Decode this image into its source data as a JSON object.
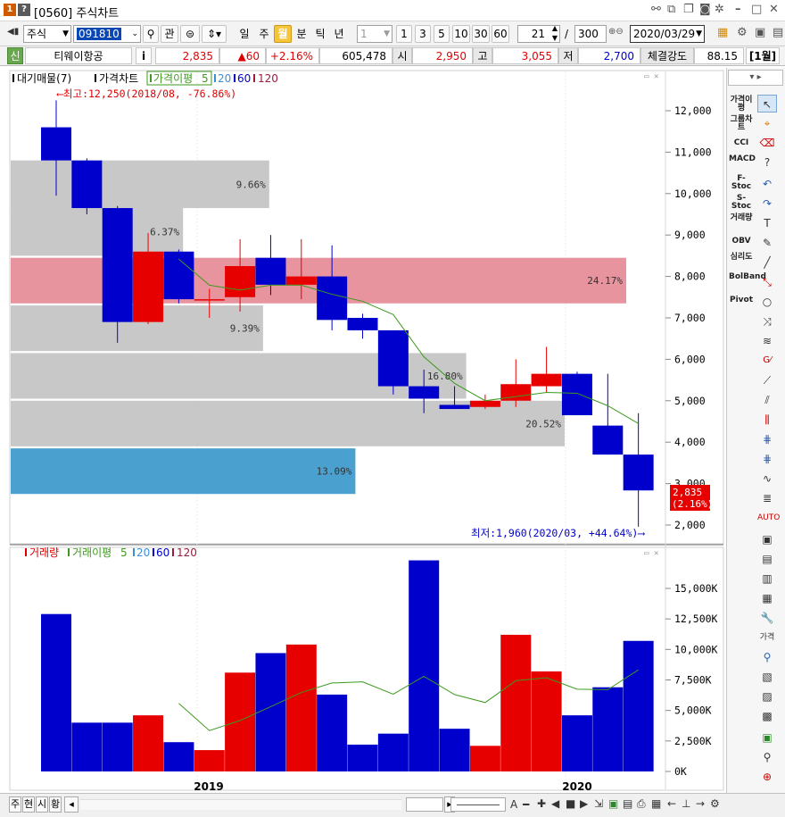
{
  "window": {
    "code_title": "[0560] 주식차트",
    "num": "1",
    "help": "?"
  },
  "toolbar": {
    "market": "주식",
    "code": "091810",
    "periods": [
      "일",
      "주",
      "월",
      "분",
      "틱",
      "년"
    ],
    "active_period": "월",
    "interval_select": "1",
    "intervals": [
      "1",
      "3",
      "5",
      "10",
      "30",
      "60"
    ],
    "count": "21",
    "count_cur": "300",
    "count_sep": "/",
    "date": "2020/03/29",
    "btn_gwan": "관"
  },
  "quote": {
    "shin": "신",
    "name": "티웨이항공",
    "info": "i",
    "price": "2,835",
    "change": "▲60",
    "change_pct": "+2.16%",
    "volume": "605,478",
    "open_label": "시",
    "open": "2,950",
    "high_label": "고",
    "high": "3,055",
    "low_label": "저",
    "low": "2,700",
    "strength_label": "체결강도",
    "strength": "88.15",
    "month": "[1월]"
  },
  "legend": {
    "vp": "대기매물(7)",
    "price": "가격차트",
    "ma_label": "가격이평",
    "ma": [
      "5",
      "20",
      "60",
      "120"
    ]
  },
  "vol_legend": {
    "vol": "거래량",
    "ma_label": "거래이평",
    "ma": [
      "5",
      "20",
      "60",
      "120"
    ]
  },
  "annotations": {
    "high": "⟵최고:12,250(2018/08, -76.86%)",
    "low": "최저:1,960(2020/03, +44.64%)⟶",
    "last_price": "2,835",
    "last_pct": "(2.16%)"
  },
  "x_labels": [
    "2019",
    "2020"
  ],
  "bottom": {
    "tabs": [
      "주",
      "현",
      "시",
      "황"
    ]
  },
  "indicators": [
    "가격이평",
    "그룹차트",
    "CCI",
    "MACD",
    "F-Stoc",
    "S-Stoc",
    "거래량",
    "OBV",
    "심리도",
    "BolBand",
    "Pivot"
  ],
  "colors": {
    "up": "#e60000",
    "down": "#0000cc",
    "ma5": "#3d9a1e",
    "vp": "#c8c8c8",
    "vp_max": "#e8949e",
    "vp_cur": "#4aa1cf"
  },
  "chart_data": {
    "type": "candlestick",
    "price_axis": {
      "min": 1500,
      "max": 12750,
      "ticks": [
        2000,
        3000,
        4000,
        5000,
        6000,
        7000,
        8000,
        9000,
        10000,
        11000,
        12000
      ]
    },
    "candles": [
      {
        "o": 11600,
        "h": 12250,
        "l": 9950,
        "c": 10800
      },
      {
        "o": 10800,
        "h": 10850,
        "l": 9500,
        "c": 9650
      },
      {
        "o": 9650,
        "h": 9700,
        "l": 6400,
        "c": 6900
      },
      {
        "o": 6900,
        "h": 9050,
        "l": 6850,
        "c": 8600
      },
      {
        "o": 8600,
        "h": 8650,
        "l": 7350,
        "c": 7450
      },
      {
        "o": 7450,
        "h": 7700,
        "l": 7000,
        "c": 7450
      },
      {
        "o": 7500,
        "h": 8900,
        "l": 7150,
        "c": 8250
      },
      {
        "o": 8450,
        "h": 9000,
        "l": 7550,
        "c": 7800
      },
      {
        "o": 7800,
        "h": 8900,
        "l": 7450,
        "c": 8000
      },
      {
        "o": 8000,
        "h": 8750,
        "l": 6700,
        "c": 6950
      },
      {
        "o": 7000,
        "h": 7100,
        "l": 6500,
        "c": 6700
      },
      {
        "o": 6700,
        "h": 6700,
        "l": 5150,
        "c": 5350
      },
      {
        "o": 5350,
        "h": 5750,
        "l": 4700,
        "c": 5050
      },
      {
        "o": 4900,
        "h": 5350,
        "l": 4800,
        "c": 4800
      },
      {
        "o": 4850,
        "h": 5150,
        "l": 4800,
        "c": 5000
      },
      {
        "o": 5000,
        "h": 6000,
        "l": 4850,
        "c": 5400
      },
      {
        "o": 5350,
        "h": 6300,
        "l": 5200,
        "c": 5650
      },
      {
        "o": 5650,
        "h": 5700,
        "l": 4650,
        "c": 4650
      },
      {
        "o": 4400,
        "h": 5650,
        "l": 3700,
        "c": 3700
      },
      {
        "o": 3700,
        "h": 4700,
        "l": 1960,
        "c": 2835
      }
    ],
    "ma5": [
      null,
      null,
      null,
      null,
      8420,
      7790,
      7670,
      7790,
      7790,
      7570,
      7400,
      7080,
      6060,
      5420,
      5000,
      5100,
      5200,
      5180,
      4880,
      4450
    ],
    "volume_axis": {
      "min": 0,
      "max": 18000,
      "ticks": [
        0,
        2500,
        5000,
        7500,
        10000,
        12500,
        15000
      ],
      "tick_labels": [
        "0K",
        "2,500K",
        "5,000K",
        "7,500K",
        "10,000K",
        "12,500K",
        "15,000K"
      ]
    },
    "volumes": [
      12900,
      4000,
      4000,
      4600,
      2400,
      1750,
      8100,
      9700,
      10400,
      6300,
      2200,
      3100,
      17300,
      3500,
      2100,
      11200,
      8200,
      4600,
      6900,
      10700
    ],
    "vol_ma5": [
      null,
      null,
      null,
      null,
      5580,
      3350,
      4170,
      5310,
      6470,
      7250,
      7340,
      6330,
      7800,
      6300,
      5650,
      7440,
      7680,
      6740,
      6700,
      8330
    ],
    "volume_profile": [
      {
        "from": 9650,
        "to": 10800,
        "pct": "9.66%"
      },
      {
        "from": 8500,
        "to": 9650,
        "pct": "6.37%"
      },
      {
        "from": 7350,
        "to": 8450,
        "pct": "24.17%"
      },
      {
        "from": 6200,
        "to": 7300,
        "pct": "9.39%"
      },
      {
        "from": 5050,
        "to": 6150,
        "pct": "16.80%"
      },
      {
        "from": 3900,
        "to": 5000,
        "pct": "20.52%"
      },
      {
        "from": 2750,
        "to": 3850,
        "pct": "13.09%"
      }
    ],
    "vp_widths": [
      0.42,
      0.28,
      1.0,
      0.41,
      0.74,
      0.9,
      0.56
    ]
  }
}
